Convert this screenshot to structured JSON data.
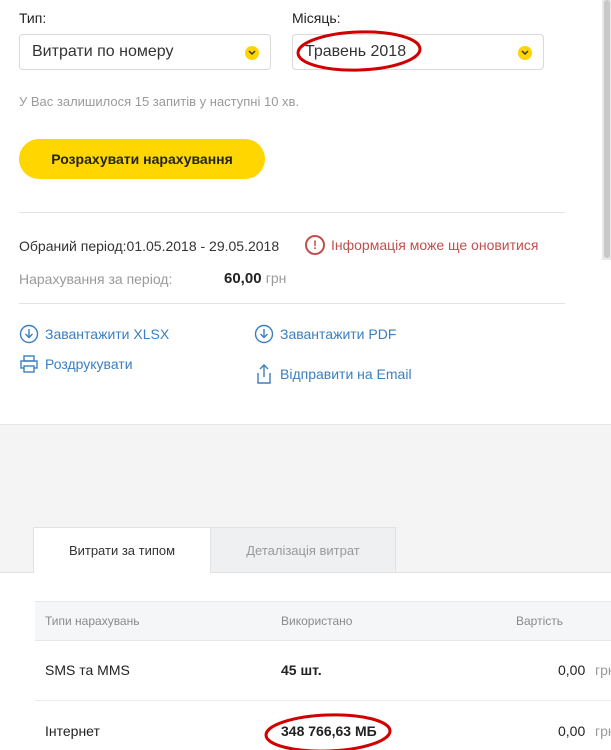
{
  "filters": {
    "type_label": "Тип:",
    "type_value": "Витрати по номеру",
    "month_label": "Місяць:",
    "month_value": "Травень 2018"
  },
  "hint": "У Вас залишилося 15 запитів у наступні 10 хв.",
  "calculate_button": "Розрахувати нарахування",
  "period": {
    "text": "Обраний період:01.05.2018 - 29.05.2018",
    "warning": "Інформація може ще оновитися",
    "accrual_label": "Нарахування за період:",
    "accrual_value": "60,00",
    "accrual_unit": "грн"
  },
  "actions": {
    "download_xlsx": "Завантажити XLSX",
    "print": "Роздрукувати",
    "download_pdf": "Завантажити PDF",
    "send_email": "Відправити на Email"
  },
  "tabs": [
    {
      "label": "Витрати за типом",
      "active": true
    },
    {
      "label": "Деталізація витрат",
      "active": false
    }
  ],
  "table": {
    "headers": [
      "Типи нарахувань",
      "Використано",
      "Вартість"
    ],
    "rows": [
      {
        "type": "SMS та MMS",
        "used": "45 шт.",
        "cost": "0,00",
        "unit": "грн"
      },
      {
        "type": "Інтернет",
        "used": "348 766,63 МБ",
        "cost": "0,00",
        "unit": "грн"
      }
    ]
  },
  "colors": {
    "accent_yellow": "#ffd600",
    "link_blue": "#3a7fc1",
    "warning_red": "#c0504d",
    "annotation_red": "#d00000"
  }
}
